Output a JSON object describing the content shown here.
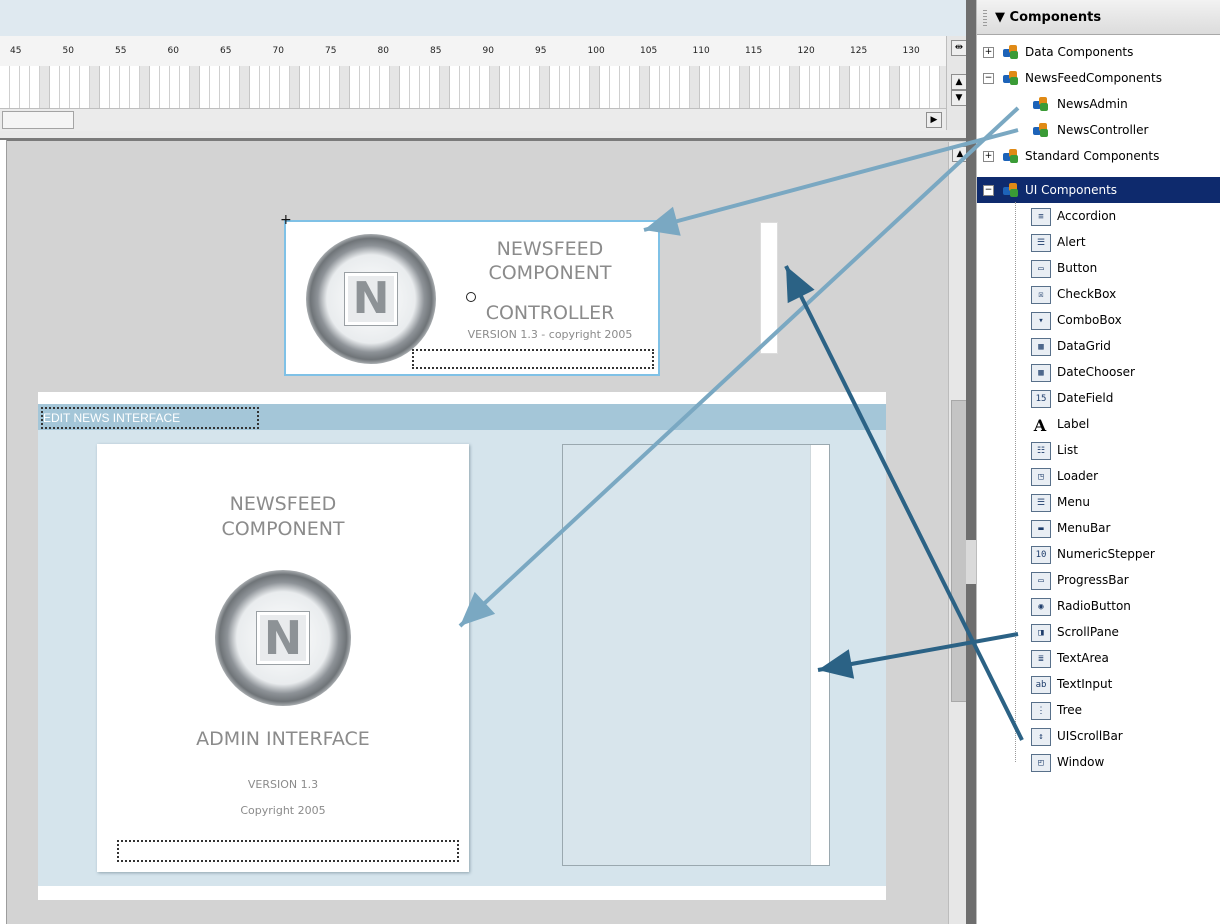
{
  "timeline": {
    "ruler_ticks": [
      "45",
      "50",
      "55",
      "60",
      "65",
      "70",
      "75",
      "80",
      "85",
      "90",
      "95",
      "100",
      "105",
      "110",
      "115",
      "120",
      "125",
      "130"
    ]
  },
  "controller": {
    "logo_letter": "N",
    "title_line1": "NEWSFEED",
    "title_line2": "COMPONENT",
    "title_line3": "CONTROLLER",
    "version": "VERSION 1.3 - copyright 2005"
  },
  "admin": {
    "bar_label": "EDIT NEWS INTERFACE",
    "card_title_line1": "NEWSFEED",
    "card_title_line2": "COMPONENT",
    "logo_letter": "N",
    "subtitle": "ADMIN INTERFACE",
    "version": "VERSION 1.3",
    "copyright": "Copyright 2005"
  },
  "panel": {
    "title": "Components",
    "categories": [
      {
        "label": "Data Components",
        "expander": "+"
      },
      {
        "label": "NewsFeedComponents",
        "expander": "−"
      },
      {
        "label": "Standard Components",
        "expander": "+"
      },
      {
        "label": "UI Components",
        "expander": "−"
      }
    ],
    "newsfeed_children": [
      "NewsAdmin",
      "NewsController"
    ],
    "ui_components": [
      {
        "label": "Accordion",
        "icon": "accordion-icon",
        "glyph": "≡"
      },
      {
        "label": "Alert",
        "icon": "alert-icon",
        "glyph": "☰"
      },
      {
        "label": "Button",
        "icon": "button-icon",
        "glyph": "▭"
      },
      {
        "label": "CheckBox",
        "icon": "checkbox-icon",
        "glyph": "☒"
      },
      {
        "label": "ComboBox",
        "icon": "combobox-icon",
        "glyph": "▾"
      },
      {
        "label": "DataGrid",
        "icon": "datagrid-icon",
        "glyph": "▦"
      },
      {
        "label": "DateChooser",
        "icon": "datechooser-icon",
        "glyph": "▦"
      },
      {
        "label": "DateField",
        "icon": "datefield-icon",
        "glyph": "15"
      },
      {
        "label": "Label",
        "icon": "label-icon",
        "glyph": "A"
      },
      {
        "label": "List",
        "icon": "list-icon",
        "glyph": "☷"
      },
      {
        "label": "Loader",
        "icon": "loader-icon",
        "glyph": "◳"
      },
      {
        "label": "Menu",
        "icon": "menu-icon",
        "glyph": "☰"
      },
      {
        "label": "MenuBar",
        "icon": "menubar-icon",
        "glyph": "▬"
      },
      {
        "label": "NumericStepper",
        "icon": "numericstepper-icon",
        "glyph": "10"
      },
      {
        "label": "ProgressBar",
        "icon": "progressbar-icon",
        "glyph": "▭"
      },
      {
        "label": "RadioButton",
        "icon": "radiobutton-icon",
        "glyph": "◉"
      },
      {
        "label": "ScrollPane",
        "icon": "scrollpane-icon",
        "glyph": "◨"
      },
      {
        "label": "TextArea",
        "icon": "textarea-icon",
        "glyph": "≣"
      },
      {
        "label": "TextInput",
        "icon": "textinput-icon",
        "glyph": "ab"
      },
      {
        "label": "Tree",
        "icon": "tree-icon",
        "glyph": "⋮"
      },
      {
        "label": "UIScrollBar",
        "icon": "uiscrollbar-icon",
        "glyph": "↕"
      },
      {
        "label": "Window",
        "icon": "window-icon",
        "glyph": "◰"
      }
    ]
  },
  "colors": {
    "arrow_light": "#7aa8c2",
    "arrow_dark": "#2b6285",
    "selection": "#0e2a6d"
  }
}
